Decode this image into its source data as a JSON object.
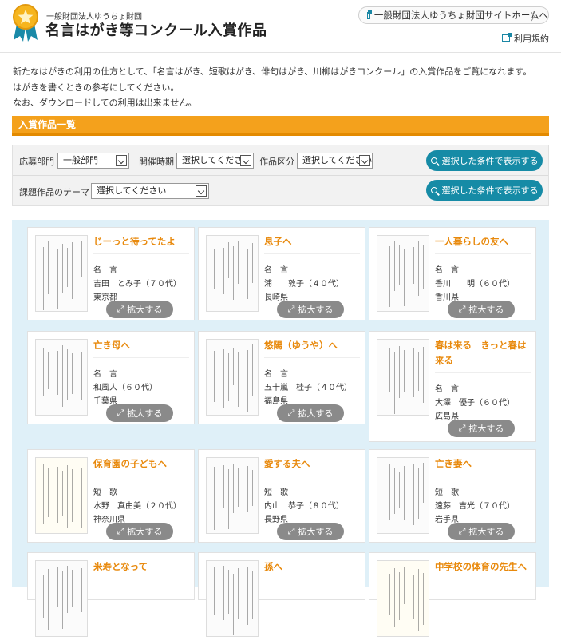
{
  "header": {
    "org_name": "一般財団法人ゆうちょ財団",
    "site_title": "名言はがき等コンクール入賞作品",
    "home_link": "一般財団法人ゆうちょ財団サイトホームへ",
    "terms_link": "利用規約"
  },
  "intro": [
    "新たなはがきの利用の仕方として、「名言はがき、短歌はがき、俳句はがき、川柳はがきコンクール」の入賞作品をご覧になれます。",
    "はがきを書くときの参考にしてください。",
    "なお、ダウンロードしての利用は出来ません。"
  ],
  "section_title": "入賞作品一覧",
  "filters": {
    "dept_label": "応募部門",
    "dept_value": "一般部門",
    "period_label": "開催時期",
    "period_value": "選択してください",
    "category_label": "作品区分",
    "category_value": "選択してください",
    "theme_label": "課題作品のテーマ",
    "theme_value": "選択してください",
    "search_label": "選択した条件で表示する"
  },
  "zoom_label": "拡大する",
  "cards": [
    {
      "title": "じーっと待ってたよ",
      "category": "名　言",
      "name": "吉田　とみ子（７０代）",
      "pref": "東京都"
    },
    {
      "title": "息子へ",
      "category": "名　言",
      "name": "浦　　敦子（４０代）",
      "pref": "長崎県"
    },
    {
      "title": "一人暮らしの友へ",
      "category": "名　言",
      "name": "香川　　明（６０代）",
      "pref": "香川県"
    },
    {
      "title": "亡き母へ",
      "category": "名　言",
      "name": "和風人（６０代）",
      "pref": "千葉県"
    },
    {
      "title": "悠陽（ゆうや）へ",
      "category": "名　言",
      "name": "五十嵐　桂子（４０代）",
      "pref": "福島県"
    },
    {
      "title": "春は来る　きっと春は来る",
      "category": "名　言",
      "name": "大澤　優子（６０代）",
      "pref": "広島県"
    },
    {
      "title": "保育園の子どもへ",
      "category": "短　歌",
      "name": "水野　真由美（２０代）",
      "pref": "神奈川県"
    },
    {
      "title": "愛する夫へ",
      "category": "短　歌",
      "name": "内山　恭子（８０代）",
      "pref": "長野県"
    },
    {
      "title": "亡き妻へ",
      "category": "短　歌",
      "name": "遠藤　吉光（７０代）",
      "pref": "岩手県"
    },
    {
      "title": "米寿となって",
      "category": "",
      "name": "",
      "pref": ""
    },
    {
      "title": "孫へ",
      "category": "",
      "name": "",
      "pref": ""
    },
    {
      "title": "中学校の体育の先生へ",
      "category": "",
      "name": "",
      "pref": ""
    }
  ],
  "colors": {
    "accent_orange": "#f4a11c",
    "title_orange": "#e8890c",
    "teal": "#168ba6",
    "grid_bg": "#dff0f8"
  }
}
